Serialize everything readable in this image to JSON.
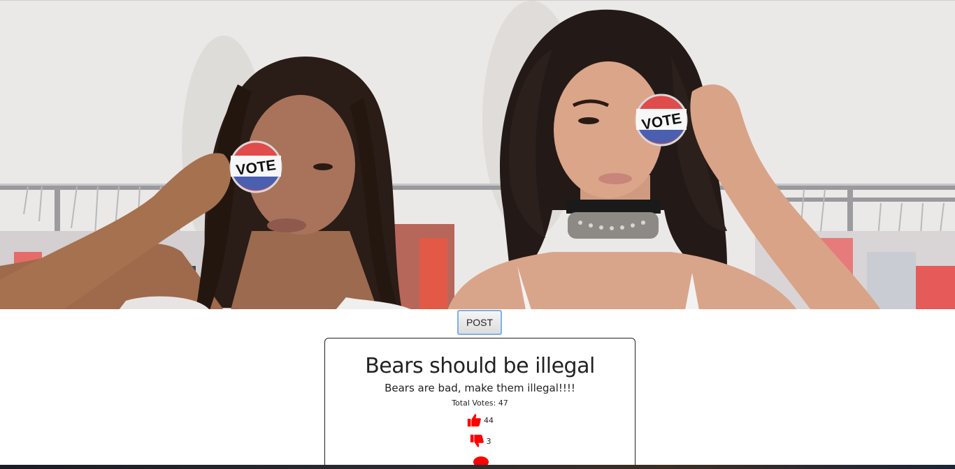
{
  "hero": {
    "badge_text": "VOTE"
  },
  "post_button": {
    "label": "POST"
  },
  "poll": {
    "title": "Bears should be illegal",
    "description": "Bears are bad, make them illegal!!!!",
    "total_votes_label": "Total Votes: 47",
    "upvotes": "44",
    "downvotes": "3"
  },
  "icons": {
    "upvote": "thumbs-up-icon",
    "downvote": "thumbs-down-icon",
    "comment": "comment-bubble-icon"
  },
  "colors": {
    "accent": "#ff0000",
    "button_focus": "#7fb0ea",
    "card_border": "#222222"
  }
}
